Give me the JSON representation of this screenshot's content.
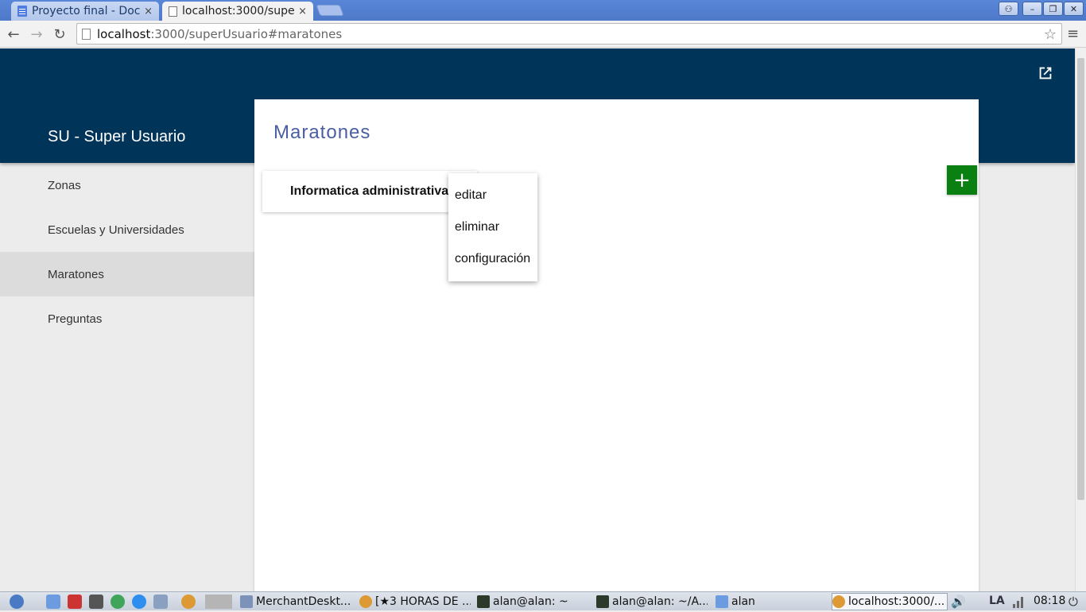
{
  "browser": {
    "tabs": [
      {
        "title": "Proyecto final - Docu",
        "close": "×"
      },
      {
        "title": "localhost:3000/supe",
        "close": "×"
      }
    ],
    "window_buttons": [
      "⚇",
      "–",
      "❐",
      "✕"
    ],
    "nav": {
      "back": "←",
      "forward": "→",
      "reload": "↻"
    },
    "url_host": "localhost",
    "url_rest": ":3000/superUsuario#maratones",
    "star": "☆",
    "menu": "≡"
  },
  "app": {
    "title": "SU - Super Usuario",
    "header_color": "#003459"
  },
  "sidebar": {
    "items": [
      {
        "label": "Zonas"
      },
      {
        "label": "Escuelas y Universidades"
      },
      {
        "label": "Maratones"
      },
      {
        "label": "Preguntas"
      }
    ]
  },
  "main": {
    "title": "Maratones",
    "card_label": "Informatica administrativa",
    "menu_items": [
      {
        "label": "editar"
      },
      {
        "label": "eliminar"
      },
      {
        "label": "configuración"
      }
    ],
    "fab_label": "+",
    "fab_color": "#0a7f12"
  },
  "taskbar": {
    "tasks": [
      {
        "label": "MerchantDeskt..."
      },
      {
        "label": "[★3 HORAS DE ..."
      },
      {
        "label": "alan@alan: ~"
      },
      {
        "label": "alan@alan: ~/A..."
      },
      {
        "label": "alan"
      },
      {
        "label": "localhost:3000/..."
      }
    ],
    "lang": "LA",
    "clock": "08:18"
  }
}
